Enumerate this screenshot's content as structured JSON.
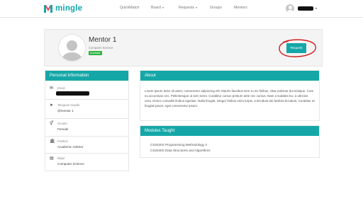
{
  "brand": {
    "name": "mingle",
    "color": "#15a7a7"
  },
  "nav": {
    "quickmatch": "QuickMatch",
    "board": "Board",
    "requests": "Requests",
    "groups": "Groups",
    "mentors": "Mentors"
  },
  "profile": {
    "name": "Mentor 1",
    "department": "Computer Science",
    "status_badge": "Available",
    "request_button": "Request"
  },
  "personal_info": {
    "title": "Personal Information",
    "email_label": "Email",
    "telegram_label": "Telegram Handle",
    "telegram_value": "@mentor 1",
    "gender_label": "Gender",
    "gender_value": "Female",
    "position_label": "Position",
    "position_value": "Academic Advisor",
    "major_label": "Major",
    "major_value": "Computer Science"
  },
  "about": {
    "title": "About",
    "text": "Lorem ipsum dolor sit amet, consectetur adipiscing elit. Mauris faucibus sem a orci finibus, vitae pulvinar dui tristique. Cras eu accumsan orci. Pellentesque ut sem tortor. Curabitur cursus pretium ante nec cursus. Nam a sodales leo, a ultricies urna. Donec convallis finibus egestas. Nulla feugiat, integer finibus enim turpis, a tincidunt dui facilisis tincidunt. Curabitur at feugiat ipsum, eget consectetur ipsum."
  },
  "modules": {
    "title": "Modules Taught",
    "items": [
      "CS2020S Programming Methodology II",
      "CS2040S Data Structures and Algorithms"
    ]
  },
  "colors": {
    "accent": "#15a7a7",
    "badge": "#2fb344",
    "annotation": "#d21f1f"
  }
}
